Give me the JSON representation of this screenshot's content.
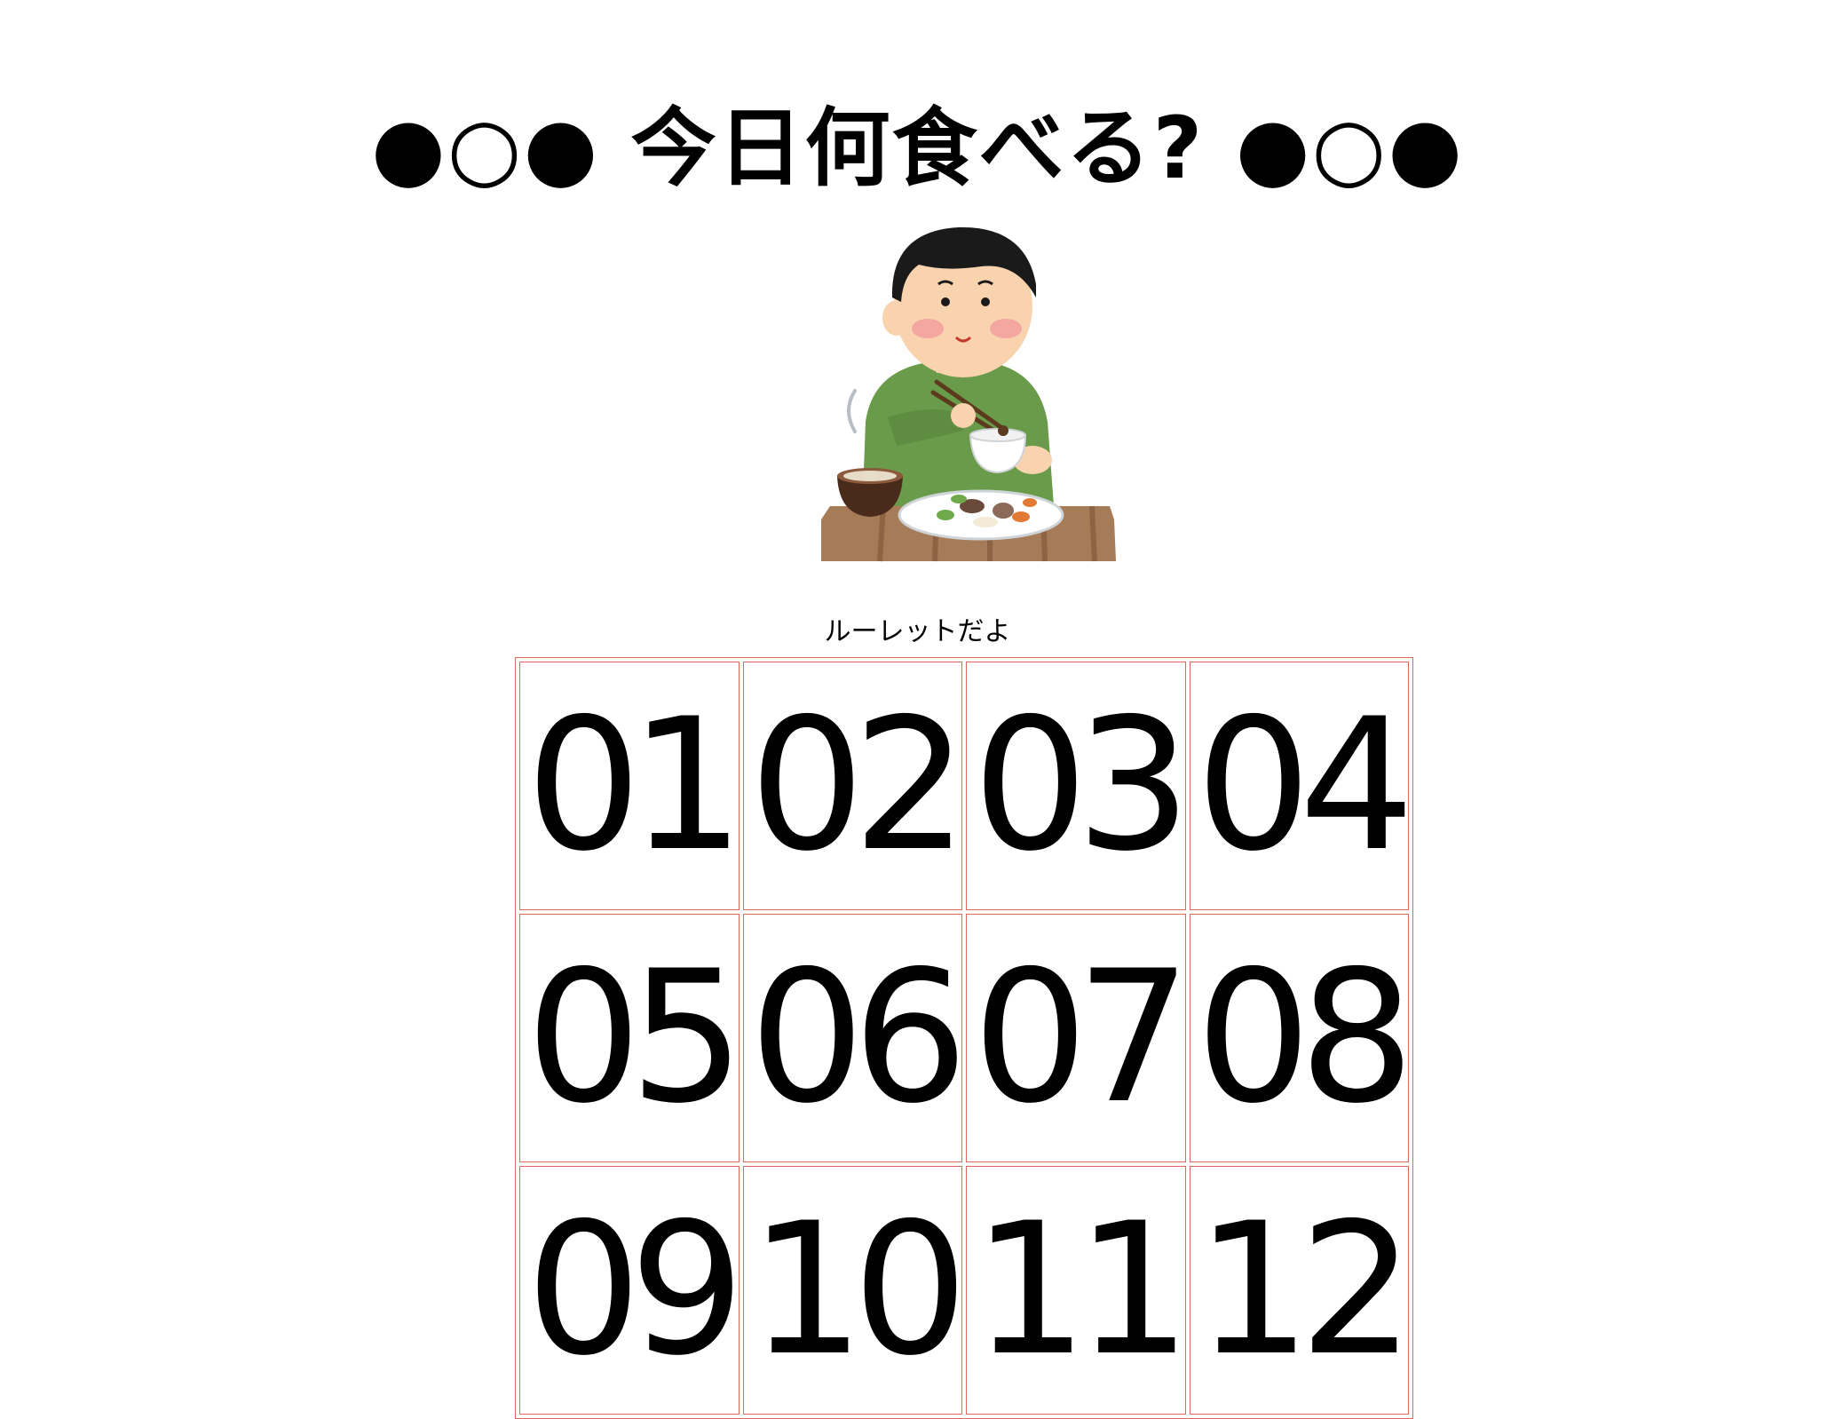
{
  "header": {
    "title": "●○● 今日何食べる? ●○●"
  },
  "illustration": {
    "icon": "person-eating-meal-icon",
    "colors": {
      "shirt": "#6a9b4a",
      "skin": "#f9d2ae",
      "hair": "#1a1a1a",
      "table": "#a67b57"
    }
  },
  "roulette": {
    "caption": "ルーレットだよ",
    "cells": [
      "01",
      "02",
      "03",
      "04",
      "05",
      "06",
      "07",
      "08",
      "09",
      "10",
      "11",
      "12"
    ],
    "border_color": "#e0675c"
  }
}
